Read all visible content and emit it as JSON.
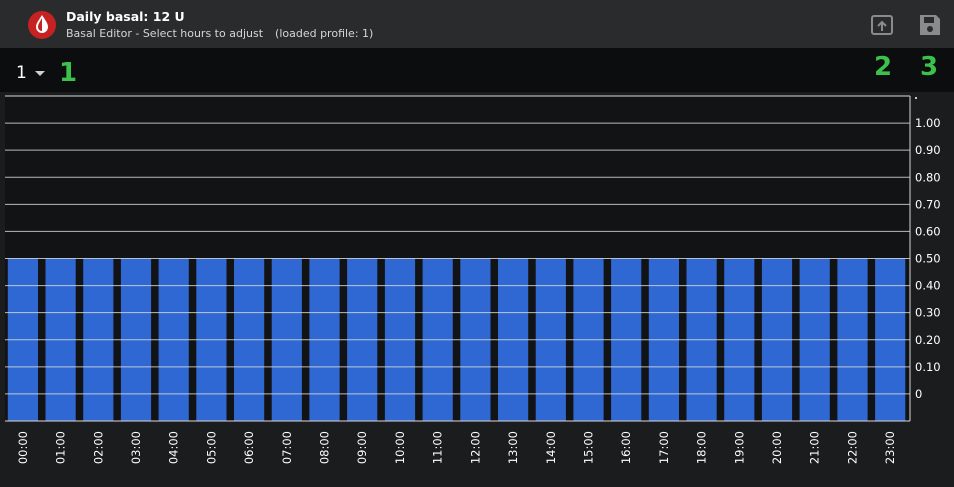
{
  "header": {
    "title": "Daily basal: 12 U",
    "subtitle_main": "Basal Editor - Select hours to adjust",
    "subtitle_profile": "(loaded profile: 1)"
  },
  "icons": {
    "app": "blood-drop-icon",
    "upload": "upload-icon",
    "save": "save-icon"
  },
  "profile_selector": {
    "value": "1"
  },
  "annotations": [
    "1",
    "2",
    "3"
  ],
  "colors": {
    "bar": "#2f68d2",
    "accent_red": "#d12a2a",
    "marker_green": "#3cc24a",
    "gridline": "#d8d8d8"
  },
  "chart_data": {
    "type": "bar",
    "categories": [
      "00:00",
      "01:00",
      "02:00",
      "03:00",
      "04:00",
      "05:00",
      "06:00",
      "07:00",
      "08:00",
      "09:00",
      "10:00",
      "11:00",
      "12:00",
      "13:00",
      "14:00",
      "15:00",
      "16:00",
      "17:00",
      "18:00",
      "19:00",
      "20:00",
      "21:00",
      "22:00",
      "23:00"
    ],
    "values": [
      0.5,
      0.5,
      0.5,
      0.5,
      0.5,
      0.5,
      0.5,
      0.5,
      0.5,
      0.5,
      0.5,
      0.5,
      0.5,
      0.5,
      0.5,
      0.5,
      0.5,
      0.5,
      0.5,
      0.5,
      0.5,
      0.5,
      0.5,
      0.5
    ],
    "yticks": [
      0,
      0.1,
      0.2,
      0.3,
      0.4,
      0.5,
      0.6,
      0.7,
      0.8,
      0.9,
      1.0
    ],
    "ytick_labels": [
      "0",
      "0.10",
      "0.20",
      "0.30",
      "0.40",
      "0.50",
      "0.60",
      "0.70",
      "0.80",
      "0.90",
      "1.00"
    ],
    "ylim": [
      -0.1,
      1.1
    ],
    "grid": true,
    "ylabel_position": "right"
  }
}
